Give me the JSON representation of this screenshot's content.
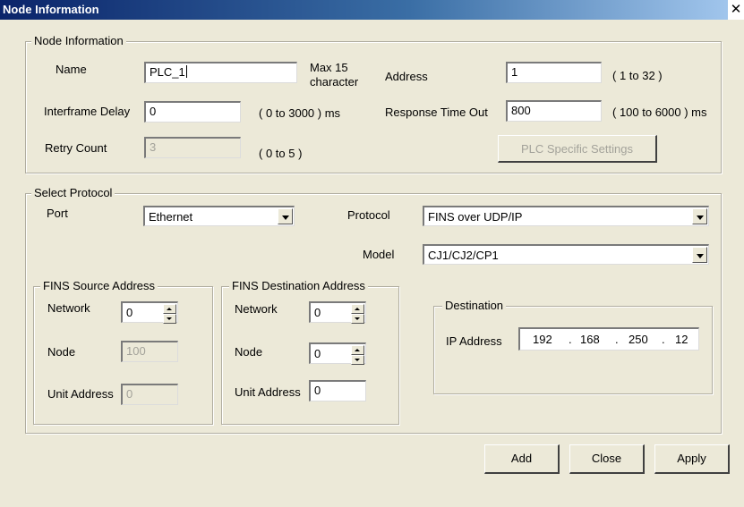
{
  "window": {
    "title": "Node Information",
    "close_glyph": "✕"
  },
  "node_info": {
    "group_label": "Node Information",
    "name_label": "Name",
    "name_value": "PLC_1",
    "name_hint_1": "Max 15",
    "name_hint_2": "character",
    "address_label": "Address",
    "address_value": "1",
    "address_hint": "( 1 to 32 )",
    "interframe_label": "Interframe Delay",
    "interframe_value": "0",
    "interframe_hint": "( 0 to 3000 ) ms",
    "response_label": "Response Time Out",
    "response_value": "800",
    "response_hint": "( 100 to 6000 ) ms",
    "retry_label": "Retry Count",
    "retry_value": "3",
    "retry_hint": "( 0 to 5 )",
    "plc_settings_label": "PLC Specific Settings"
  },
  "protocol": {
    "group_label": "Select Protocol",
    "port_label": "Port",
    "port_value": "Ethernet",
    "protocol_label": "Protocol",
    "protocol_value": "FINS over UDP/IP",
    "model_label": "Model",
    "model_value": "CJ1/CJ2/CP1"
  },
  "fins_source": {
    "group_label": "FINS Source Address",
    "network_label": "Network",
    "network_value": "0",
    "node_label": "Node",
    "node_value": "100",
    "unit_label": "Unit Address",
    "unit_value": "0"
  },
  "fins_dest": {
    "group_label": "FINS Destination Address",
    "network_label": "Network",
    "network_value": "0",
    "node_label": "Node",
    "node_value": "0",
    "unit_label": "Unit Address",
    "unit_value": "0"
  },
  "destination": {
    "group_label": "Destination",
    "ip_label": "IP Address",
    "ip_1": "192",
    "ip_2": "168",
    "ip_3": "250",
    "ip_4": "12",
    "dot": "."
  },
  "buttons": {
    "add": "Add",
    "close": "Close",
    "apply": "Apply"
  }
}
